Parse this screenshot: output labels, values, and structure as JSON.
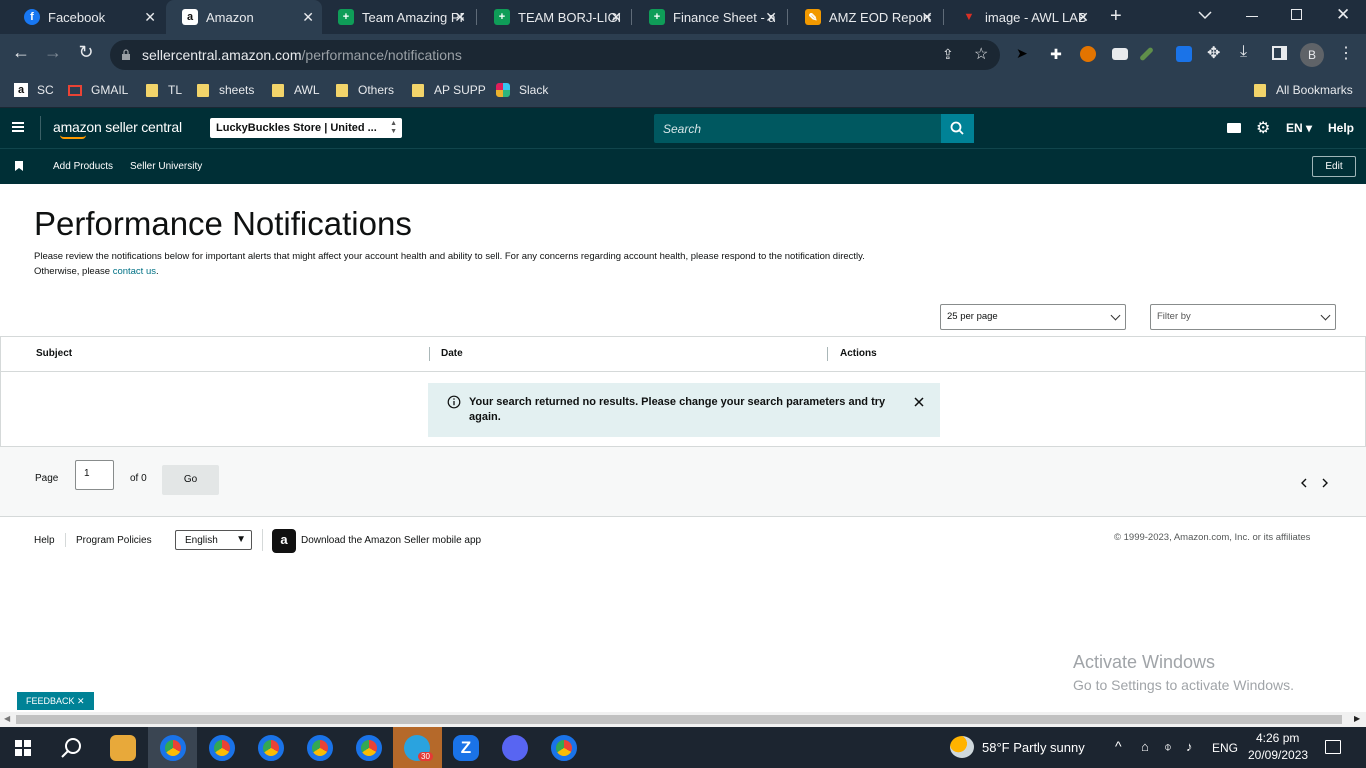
{
  "browser": {
    "tabs": [
      {
        "title": "Facebook",
        "icon": "facebook-icon",
        "color": "#1877f2",
        "glyph": "f"
      },
      {
        "title": "Amazon",
        "icon": "amazon-icon",
        "color": "#ffffff",
        "glyph": "a",
        "active": true
      },
      {
        "title": "Team Amazing PP",
        "icon": "sheets-icon",
        "color": "#0f9d58",
        "glyph": "+"
      },
      {
        "title": "TEAM BORJ-LIGH",
        "icon": "sheets-icon",
        "color": "#0f9d58",
        "glyph": "+"
      },
      {
        "title": "Finance Sheet - a",
        "icon": "sheets-icon",
        "color": "#0f9d58",
        "glyph": "+"
      },
      {
        "title": "AMZ EOD Report",
        "icon": "report-icon",
        "color": "#f29900",
        "glyph": "✎"
      },
      {
        "title": "image - AWL LAB",
        "icon": "image-icon",
        "color": "#d93025",
        "glyph": "▼"
      }
    ],
    "tab_close_glyph": "✕",
    "new_tab_glyph": "+",
    "url_host": "sellercentral.amazon.com",
    "url_path": "/performance/notifications",
    "profile_initial": "B",
    "bookmarks": [
      {
        "label": "SC",
        "icon": "amazon-icon"
      },
      {
        "label": "GMAIL",
        "icon": "gmail-icon"
      },
      {
        "label": "TL",
        "icon": "folder-icon"
      },
      {
        "label": "sheets",
        "icon": "folder-icon"
      },
      {
        "label": "AWL",
        "icon": "folder-icon"
      },
      {
        "label": "Others",
        "icon": "folder-icon"
      },
      {
        "label": "AP SUPP",
        "icon": "folder-icon"
      },
      {
        "label": "Slack",
        "icon": "slack-icon"
      }
    ],
    "all_bookmarks": "All Bookmarks"
  },
  "sc": {
    "logo_text": "amazon seller central",
    "store": "LuckyBuckles Store | United ...",
    "search_placeholder": "Search",
    "lang": "EN",
    "help": "Help",
    "subnav": [
      "Add Products",
      "Seller University"
    ],
    "edit": "Edit"
  },
  "page": {
    "title": "Performance Notifications",
    "desc_part1": "Please review the notifications below for important alerts that might affect your account health and ability to sell. For any concerns regarding account health, please respond to the notification directly. Otherwise, please ",
    "desc_link": "contact us",
    "desc_end": ".",
    "per_page": "25 per page",
    "filter": "Filter by",
    "columns": [
      "Subject",
      "Date",
      "Actions"
    ],
    "empty_message": "Your search returned no results. Please change your search parameters and try again.",
    "pager": {
      "label": "Page",
      "value": "1",
      "of": "of 0",
      "go": "Go"
    }
  },
  "footer": {
    "help": "Help",
    "policies": "Program Policies",
    "language": "English",
    "app": "Download the Amazon Seller mobile app",
    "copyright": "© 1999-2023, Amazon.com, Inc. or its affiliates"
  },
  "overlay": {
    "watermark_title": "Activate Windows",
    "watermark_sub": "Go to Settings to activate Windows.",
    "feedback": "FEEDBACK",
    "feedback_close": "✕"
  },
  "taskbar": {
    "weather": "58°F  Partly sunny",
    "lang": "ENG",
    "time": "4:26 pm",
    "date": "20/09/2023",
    "telegram_badge": "30"
  }
}
